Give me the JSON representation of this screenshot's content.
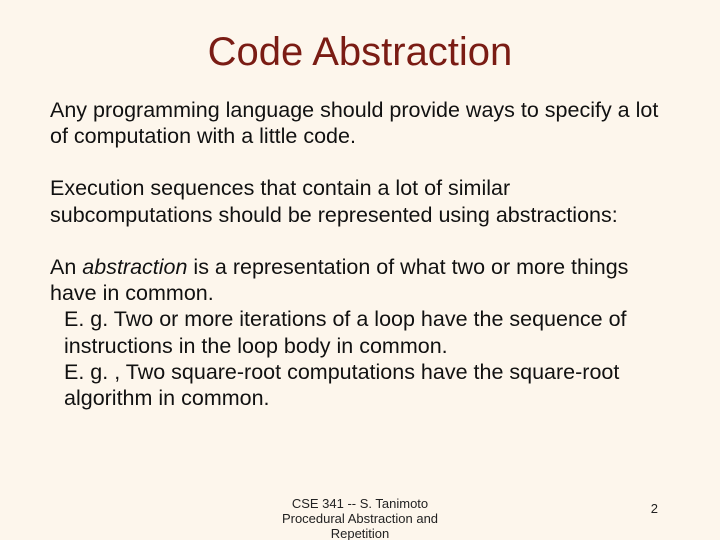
{
  "title": "Code Abstraction",
  "para1": "Any programming language should provide ways to specify a lot of computation with a little code.",
  "para2": "Execution sequences that contain a lot of similar subcomputations should be represented using abstractions:",
  "def_pre": "An ",
  "def_term": "abstraction",
  "def_post": " is a representation of what two or more things have in common.",
  "eg1": "  E. g.  Two or more iterations of a loop have the sequence of instructions in the loop body in common.",
  "eg2": "  E. g. , Two square-root computations have the square-root algorithm in common.",
  "footer_line1": "CSE 341 -- S. Tanimoto",
  "footer_line2": "Procedural Abstraction and",
  "footer_line3": "Repetition",
  "page_number": "2"
}
